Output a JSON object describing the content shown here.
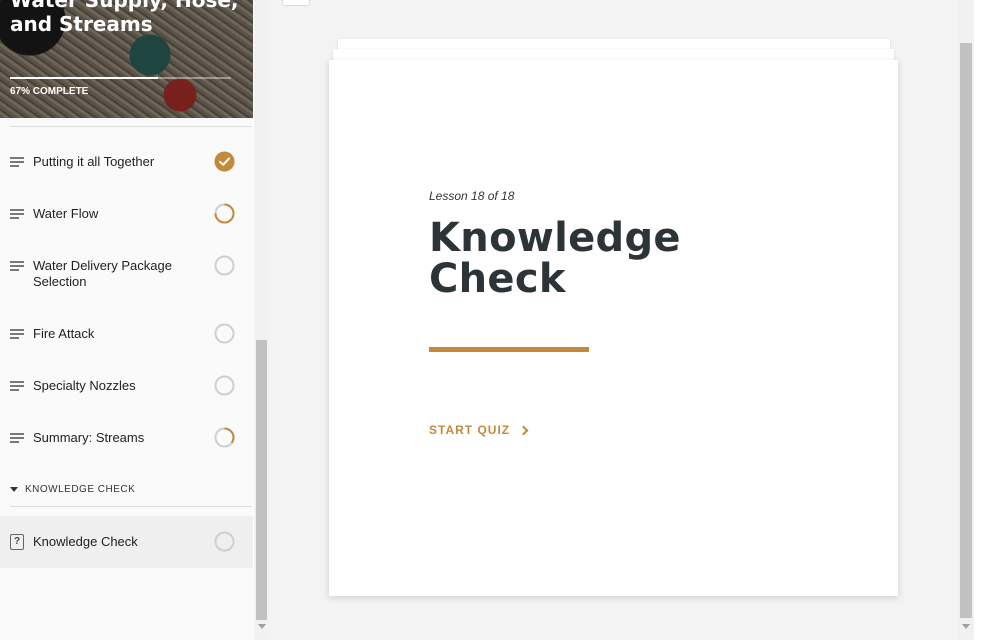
{
  "course": {
    "title": "Water Supply, Hose, and Streams",
    "progress_percent": 67,
    "progress_text": "67% COMPLETE"
  },
  "lessons": [
    {
      "label": "Putting it all Together",
      "status": "complete",
      "icon": "lines-icon"
    },
    {
      "label": "Water Flow",
      "status": "in-progress",
      "progress": 0.75,
      "icon": "lines-icon"
    },
    {
      "label": "Water Delivery Package Selection",
      "status": "not-started",
      "icon": "lines-icon"
    },
    {
      "label": "Fire Attack",
      "status": "not-started",
      "icon": "lines-icon"
    },
    {
      "label": "Specialty Nozzles",
      "status": "not-started",
      "icon": "lines-icon"
    },
    {
      "label": "Summary: Streams",
      "status": "in-progress",
      "progress": 0.35,
      "icon": "lines-icon"
    }
  ],
  "section": {
    "label": "KNOWLEDGE CHECK"
  },
  "section_lessons": [
    {
      "label": "Knowledge Check",
      "status": "not-started",
      "icon": "quiz-icon",
      "icon_glyph": "?"
    }
  ],
  "card": {
    "counter": "Lesson 18 of 18",
    "title": "Knowledge Check",
    "start_label": "START QUIZ"
  },
  "colors": {
    "accent": "#c48a3a",
    "title": "#2c3437",
    "ring": "#cfcfcf"
  }
}
